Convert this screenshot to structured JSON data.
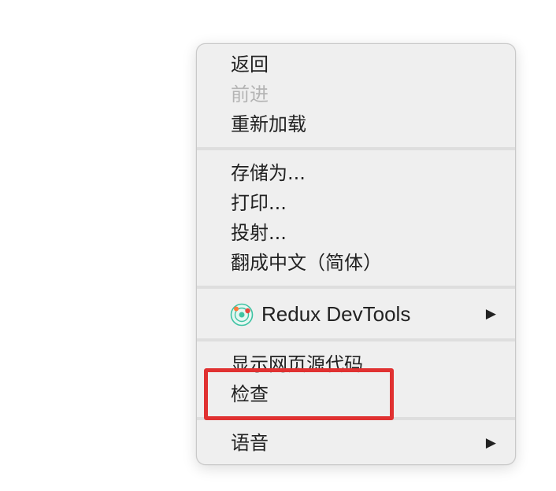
{
  "context_menu": {
    "items": {
      "back": "返回",
      "forward": "前进",
      "reload": "重新加载",
      "save_as": "存储为...",
      "print": "打印...",
      "cast": "投射...",
      "translate": "翻成中文（简体）",
      "redux_devtools": "Redux DevTools",
      "view_source": "显示网页源代码",
      "inspect": "检查",
      "speech": "语音"
    },
    "submenu_arrow": "▶",
    "disabled_color": "#b4b4b4",
    "highlight_color": "#e03131"
  }
}
